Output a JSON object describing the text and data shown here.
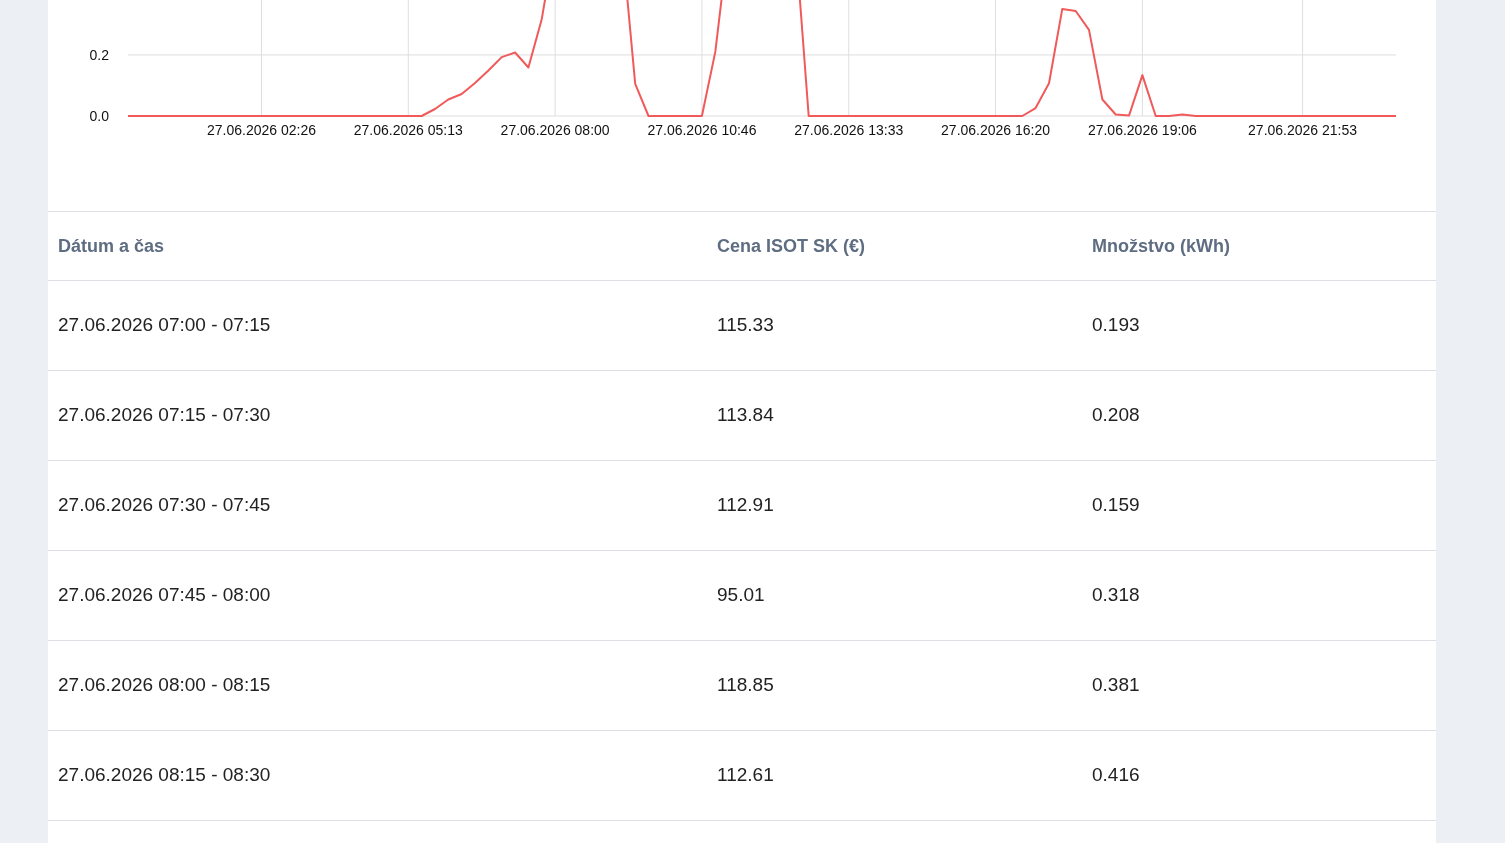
{
  "chart_data": {
    "type": "line",
    "categories": [
      null,
      null,
      null,
      null,
      null,
      null,
      null,
      null,
      null,
      null,
      "27.06.2026 02:26",
      null,
      null,
      null,
      null,
      null,
      null,
      null,
      null,
      null,
      null,
      "27.06.2026 05:13",
      null,
      null,
      null,
      null,
      null,
      null,
      null,
      null,
      null,
      null,
      "27.06.2026 08:00",
      null,
      null,
      null,
      null,
      null,
      null,
      null,
      null,
      null,
      null,
      "27.06.2026 10:46",
      null,
      null,
      null,
      null,
      null,
      null,
      null,
      null,
      null,
      null,
      "27.06.2026 13:33",
      null,
      null,
      null,
      null,
      null,
      null,
      null,
      null,
      null,
      null,
      "27.06.2026 16:20",
      null,
      null,
      null,
      null,
      null,
      null,
      null,
      null,
      null,
      null,
      "27.06.2026 19:06",
      null,
      null,
      null,
      null,
      null,
      null,
      null,
      null,
      null,
      null,
      null,
      "27.06.2026 21:53",
      null,
      null,
      null,
      null,
      null,
      null,
      null
    ],
    "ylim": [
      0,
      0.38
    ],
    "grid": true,
    "series": [
      {
        "color": "#f05a5a",
        "values": [
          0,
          0,
          0,
          0,
          0,
          0,
          0,
          0,
          0,
          0,
          0,
          0,
          0,
          0,
          0,
          0,
          0,
          0,
          0,
          0,
          0,
          0,
          0,
          0.023,
          0.054,
          0.072,
          0.108,
          0.149,
          0.193,
          0.208,
          0.159,
          0.318,
          null,
          null,
          null,
          null,
          null,
          null,
          0.105,
          0,
          0,
          0,
          0,
          0,
          0.21,
          null,
          null,
          null,
          null,
          null,
          null,
          0,
          0,
          0,
          0,
          0,
          0,
          0,
          0,
          0,
          0,
          0,
          0,
          0,
          0,
          0,
          0,
          0,
          0.026,
          0.107,
          0.351,
          0.344,
          0.282,
          0.054,
          0.005,
          0.002,
          0.134,
          0,
          0,
          0.005,
          0,
          0,
          0,
          0,
          0,
          0,
          0,
          0,
          0,
          0,
          0,
          0,
          0,
          0,
          0,
          0
        ]
      }
    ],
    "yticks": [
      {
        "value": 0,
        "label": "0.0"
      },
      {
        "value": 0.2,
        "label": "0.2"
      }
    ]
  },
  "table": {
    "columns": [
      "Dátum a čas",
      "Cena ISOT SK (€)",
      "Množstvo (kWh)"
    ],
    "rows": [
      [
        "27.06.2026 07:00 - 07:15",
        "115.33",
        "0.193"
      ],
      [
        "27.06.2026 07:15 - 07:30",
        "113.84",
        "0.208"
      ],
      [
        "27.06.2026 07:30 - 07:45",
        "112.91",
        "0.159"
      ],
      [
        "27.06.2026 07:45 - 08:00",
        "95.01",
        "0.318"
      ],
      [
        "27.06.2026 08:00 - 08:15",
        "118.85",
        "0.381"
      ],
      [
        "27.06.2026 08:15 - 08:30",
        "112.61",
        "0.416"
      ]
    ]
  }
}
